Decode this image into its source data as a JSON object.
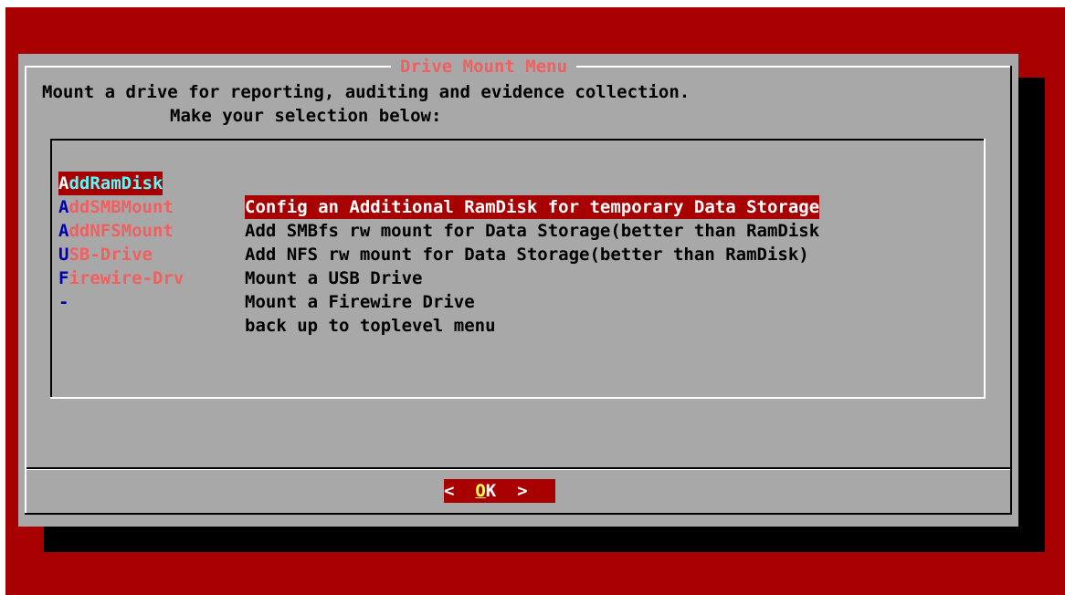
{
  "dialog": {
    "title": "Drive Mount Menu",
    "prompt_line1": "Mount a drive for reporting, auditing and evidence collection.",
    "prompt_line2": "Make your selection below:"
  },
  "menu": {
    "items": [
      {
        "hot": "A",
        "rest": "ddRamDisk",
        "desc": "Config an Additional RamDisk for temporary Data Storage",
        "selected": true
      },
      {
        "hot": "A",
        "rest": "ddSMBMount",
        "desc": "Add SMBfs rw mount for Data Storage(better than RamDisk",
        "selected": false
      },
      {
        "hot": "A",
        "rest": "ddNFSMount",
        "desc": "Add NFS rw mount for Data Storage(better than RamDisk)",
        "selected": false
      },
      {
        "hot": "U",
        "rest": "SB-Drive",
        "desc": "Mount a USB Drive",
        "selected": false
      },
      {
        "hot": "F",
        "rest": "irewire-Drv",
        "desc": "Mount a Firewire Drive",
        "selected": false
      },
      {
        "hot": "-",
        "rest": "",
        "desc": "back up to toplevel menu",
        "selected": false
      }
    ]
  },
  "buttons": {
    "ok": {
      "left": "<  ",
      "hot": "O",
      "rest": "K",
      "right": "  >"
    }
  },
  "colors": {
    "background": "#a80000",
    "dialog": "#a8a8a8",
    "title_text": "#f06060",
    "selected_bg": "#a80000",
    "hotkey": "#0000a8"
  }
}
